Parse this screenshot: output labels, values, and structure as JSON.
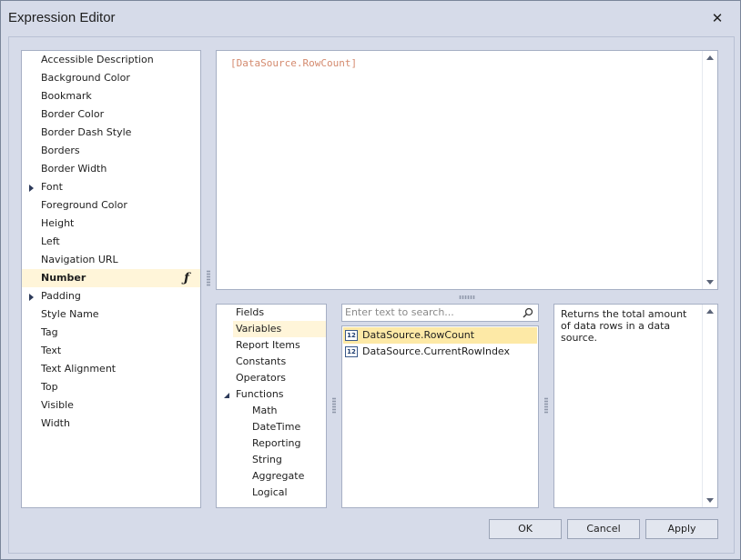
{
  "window": {
    "title": "Expression Editor",
    "close_symbol": "✕"
  },
  "properties": {
    "items": [
      {
        "label": "Accessible Description",
        "expandable": false
      },
      {
        "label": "Background Color",
        "expandable": false
      },
      {
        "label": "Bookmark",
        "expandable": false
      },
      {
        "label": "Border Color",
        "expandable": false
      },
      {
        "label": "Border Dash Style",
        "expandable": false
      },
      {
        "label": "Borders",
        "expandable": false
      },
      {
        "label": "Border Width",
        "expandable": false
      },
      {
        "label": "Font",
        "expandable": true
      },
      {
        "label": "Foreground Color",
        "expandable": false
      },
      {
        "label": "Height",
        "expandable": false
      },
      {
        "label": "Left",
        "expandable": false
      },
      {
        "label": "Navigation URL",
        "expandable": false
      },
      {
        "label": "Number",
        "expandable": false,
        "selected": true,
        "icon": "function-icon",
        "icon_glyph": "ƒ"
      },
      {
        "label": "Padding",
        "expandable": true
      },
      {
        "label": "Style Name",
        "expandable": false
      },
      {
        "label": "Tag",
        "expandable": false
      },
      {
        "label": "Text",
        "expandable": false
      },
      {
        "label": "Text Alignment",
        "expandable": false
      },
      {
        "label": "Top",
        "expandable": false
      },
      {
        "label": "Visible",
        "expandable": false
      },
      {
        "label": "Width",
        "expandable": false
      }
    ]
  },
  "expression": {
    "text": "[DataSource.RowCount]",
    "color": "#d48a6e"
  },
  "categories": {
    "items": [
      {
        "label": "Fields"
      },
      {
        "label": "Variables",
        "selected": true
      },
      {
        "label": "Report Items"
      },
      {
        "label": "Constants"
      },
      {
        "label": "Operators"
      },
      {
        "label": "Functions",
        "expanded": true
      },
      {
        "label": "Math",
        "child": true
      },
      {
        "label": "DateTime",
        "child": true
      },
      {
        "label": "Reporting",
        "child": true
      },
      {
        "label": "String",
        "child": true
      },
      {
        "label": "Aggregate",
        "child": true
      },
      {
        "label": "Logical",
        "child": true
      }
    ]
  },
  "search": {
    "placeholder": "Enter text to search..."
  },
  "variables": {
    "icon_text": "12",
    "items": [
      {
        "label": "DataSource.RowCount",
        "selected": true
      },
      {
        "label": "DataSource.CurrentRowIndex"
      }
    ]
  },
  "description": {
    "text": "Returns the total amount of data rows in a data source."
  },
  "buttons": {
    "ok": "OK",
    "cancel": "Cancel",
    "apply": "Apply"
  },
  "colors": {
    "selection": "#fff5d9",
    "item_selection": "#fde9a6",
    "window_bg": "#d6dbe9"
  }
}
